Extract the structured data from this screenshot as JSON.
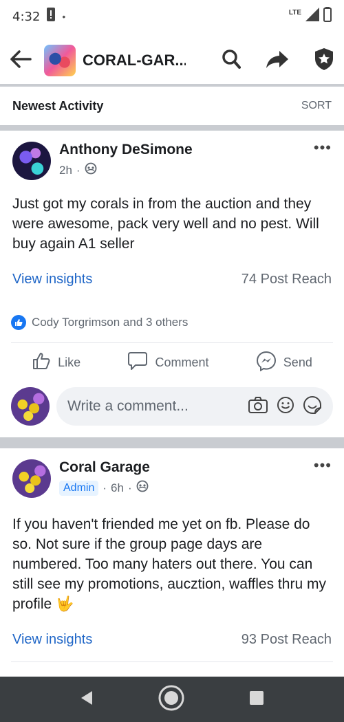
{
  "status_bar": {
    "time": "4:32",
    "network": "LTE"
  },
  "app_bar": {
    "title": "CORAL-GAR..."
  },
  "feed_header": {
    "title": "Newest Activity",
    "sort_label": "SORT"
  },
  "posts": [
    {
      "author": "Anthony DeSimone",
      "time": "2h",
      "body": "Just got my corals in from the auction and they were awesome, pack very well and no pest. Will buy again A1 seller",
      "insights_label": "View insights",
      "reach": "74 Post Reach",
      "reactions_text": "Cody Torgrimson and 3 others",
      "actions": {
        "like": "Like",
        "comment": "Comment",
        "send": "Send"
      },
      "comment_placeholder": "Write a comment..."
    },
    {
      "author": "Coral Garage",
      "badge": "Admin",
      "time": "6h",
      "body": "If you haven't friended me yet on fb. Please do so. Not sure if the group page days are numbered. Too many haters out there. You can still see my promotions, aucztion, waffles thru my profile",
      "body_emoji": "🤟",
      "insights_label": "View insights",
      "reach": "93 Post Reach"
    }
  ],
  "colors": {
    "link_blue": "#1f66c7",
    "like_blue": "#1877f2",
    "nav_bar": "#3a3e41"
  }
}
